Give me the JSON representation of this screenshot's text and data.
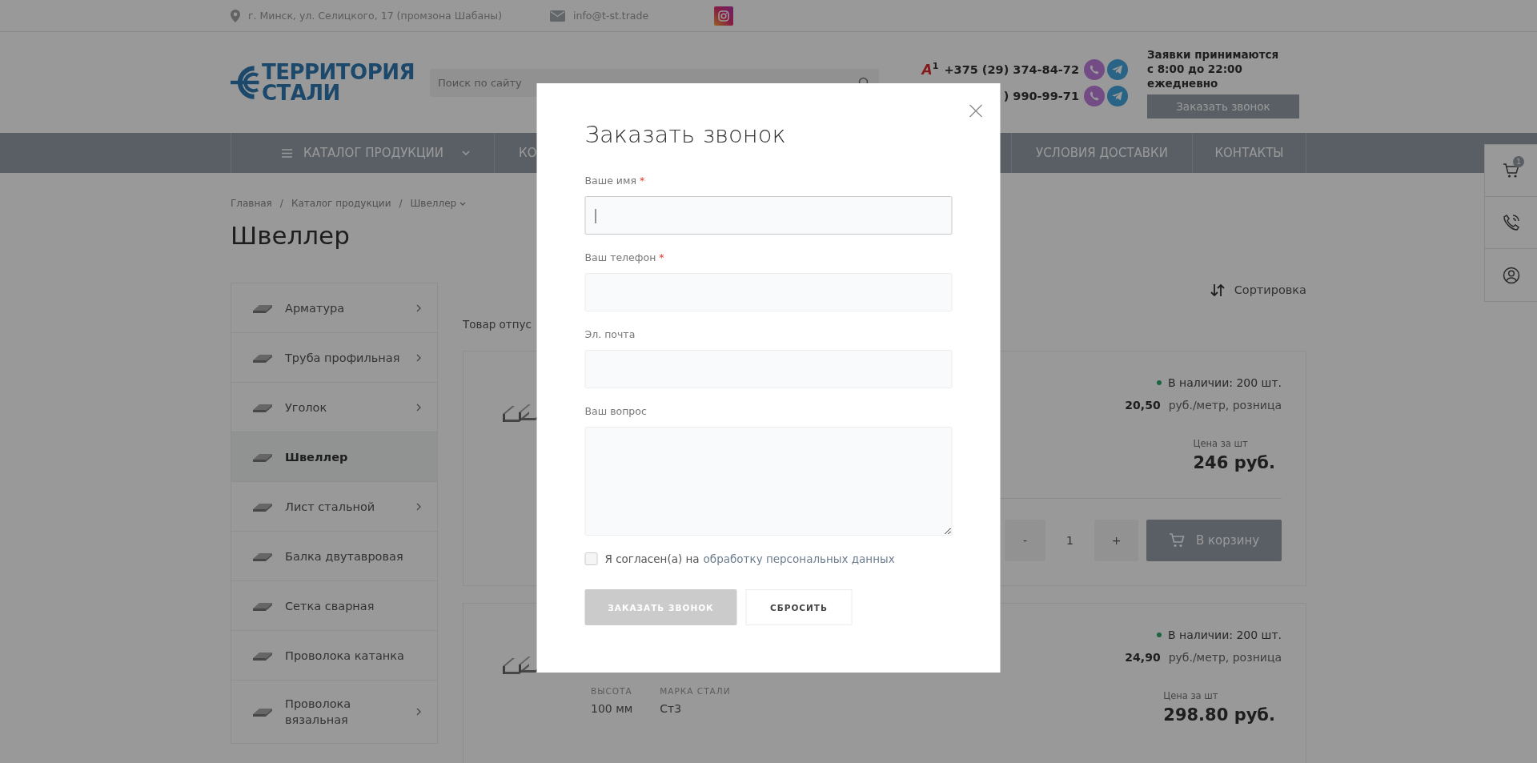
{
  "top_bar": {
    "address": "г. Минск, ул. Селицкого, 17 (промзона Шабаны)",
    "email": "info@t-st.trade"
  },
  "header": {
    "logo_lines": [
      "ТЕРРИТОРИЯ",
      "СТАЛИ"
    ],
    "search": {
      "placeholder": "Поиск по сайту"
    },
    "phones": [
      {
        "badge": "A$^{1}$",
        "number": "+375 (29) 374-84-72"
      },
      {
        "number": ") 990-99-71"
      }
    ],
    "hours_lines": [
      "Заявки принимаются",
      "с 8:00 до 22:00",
      "ежедневно"
    ],
    "callback_button": "Заказать звонок"
  },
  "nav": [
    {
      "label": "КАТАЛОГ ПРОДУКЦИИ",
      "kind": "catalog"
    },
    {
      "label": "КО",
      "kind": "link"
    },
    {
      "label": "УСЛОВИЯ ДОСТАВКИ",
      "kind": "link"
    },
    {
      "label": "КОНТАКТЫ",
      "kind": "link"
    }
  ],
  "side_panel": {
    "cart_count": "1"
  },
  "breadcrumb": [
    {
      "label": "Главная",
      "dropdown": false
    },
    {
      "separator": "/",
      "label": "Каталог продукции",
      "dropdown": false
    },
    {
      "separator": "/",
      "label": "Швеллер",
      "dropdown": true
    }
  ],
  "title": "Швеллер",
  "sidebar": [
    {
      "label": "Арматура",
      "selected": false,
      "has_children": true
    },
    {
      "label": "Труба профильная",
      "selected": false,
      "has_children": true
    },
    {
      "label": "Уголок",
      "selected": false,
      "has_children": true
    },
    {
      "label": "Швеллер",
      "selected": true,
      "has_children": false
    },
    {
      "label": "Лист стальной",
      "selected": false,
      "has_children": true
    },
    {
      "label": "Балка двутавровая",
      "selected": false,
      "has_children": false
    },
    {
      "label": "Сетка сварная",
      "selected": false,
      "has_children": false
    },
    {
      "label": "Проволока катанка",
      "selected": false,
      "has_children": false
    },
    {
      "label": "Проволока вязальная",
      "selected": false,
      "has_children": true
    }
  ],
  "sort_label": "Сортировка",
  "notice": "Товар отпус",
  "products": [
    {
      "available": true,
      "stock": "В наличии: 200 шт.",
      "price": "20,50",
      "unit": "руб./метр, розница",
      "price_label": "Цена за шт",
      "total": "246 руб.",
      "cart": {
        "minus": "-",
        "quantity": "1",
        "plus": "+",
        "button": "В корзину"
      }
    },
    {
      "available": true,
      "stock": "В наличии: 200 шт.",
      "price": "24,90",
      "unit": "руб./метр, розница",
      "price_label": "Цена за шт",
      "total": "298.80 руб.",
      "specs": [
        {
          "label": "ВЫСОТА",
          "value": "100 мм"
        },
        {
          "label": "МАРКА СТАЛИ",
          "value": "Ст3"
        }
      ]
    }
  ],
  "modal": {
    "title": "Заказать звонок",
    "fields": [
      {
        "label": "Ваше имя",
        "required_mark": "*",
        "kind": "input",
        "focused": true
      },
      {
        "label": "Ваш телефон",
        "required_mark": "*",
        "kind": "input",
        "focused": false
      },
      {
        "label": "Эл. почта",
        "kind": "input",
        "focused": false
      },
      {
        "label": "Ваш вопрос",
        "kind": "textarea",
        "focused": false
      }
    ],
    "consent": {
      "checked": false,
      "text": "Я согласен(а) на",
      "link": "обработку персональных данных"
    },
    "submit": {
      "label": "ЗАКАЗАТЬ ЗВОНОК",
      "disabled": true
    },
    "reset": "СБРОСИТЬ"
  }
}
